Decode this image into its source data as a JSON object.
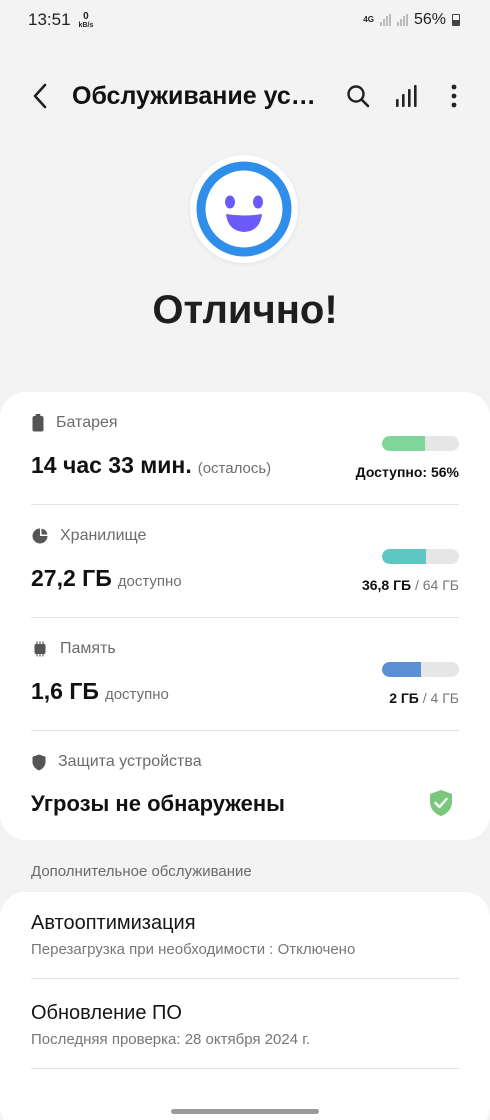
{
  "status_bar": {
    "time": "13:51",
    "net_speed_value": "0",
    "net_speed_unit": "kB/s",
    "network_type": "4G",
    "battery_percent": "56%"
  },
  "app_bar": {
    "title": "Обслуживание устройства",
    "back_icon": "back-arrow-icon",
    "search_icon": "search-icon",
    "stats_icon": "bar-chart-icon",
    "more_icon": "more-vertical-icon"
  },
  "hero": {
    "status_text": "Отлично!",
    "face_icon": "smiling-face-icon"
  },
  "items": {
    "battery": {
      "label": "Батарея",
      "value": "14 час 33 мин.",
      "suffix": "(осталось)",
      "caption": "Доступно: 56%",
      "level": 0.56,
      "color": "#7fd69a"
    },
    "storage": {
      "label": "Хранилище",
      "value": "27,2 ГБ",
      "suffix": "доступно",
      "caption_used": "36,8 ГБ",
      "caption_total": " / 64 ГБ",
      "level": 0.575,
      "color": "#5cc7c3"
    },
    "memory": {
      "label": "Память",
      "value": "1,6 ГБ",
      "suffix": "доступно",
      "caption_used": "2 ГБ",
      "caption_total": " / 4 ГБ",
      "level": 0.5,
      "color": "#5b8fd6"
    },
    "protection": {
      "label": "Защита устройства",
      "value": "Угрозы не обнаружены",
      "shield_color": "#7cc77e"
    }
  },
  "additional": {
    "header": "Дополнительное обслуживание",
    "auto_opt_title": "Автооптимизация",
    "auto_opt_sub": "Перезагрузка при необходимости : Отключено",
    "update_title": "Обновление ПО",
    "update_sub": "Последняя проверка: 28 октября 2024 г."
  },
  "colors": {
    "accent_blue": "#2f8eea",
    "face_purple": "#6a5af9"
  }
}
